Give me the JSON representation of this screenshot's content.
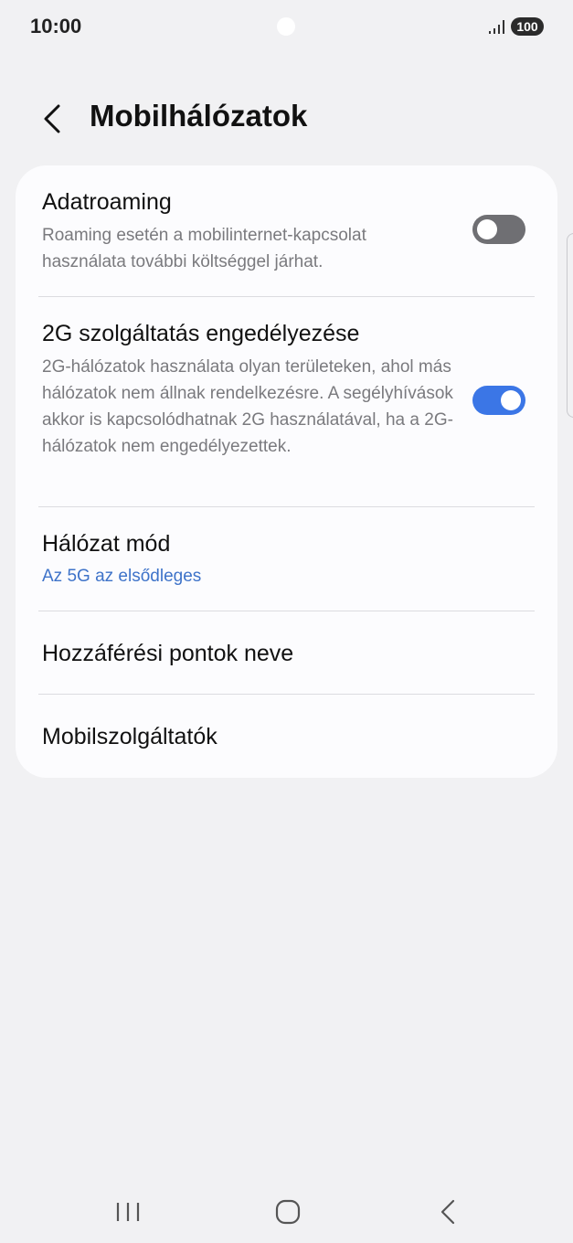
{
  "status_bar": {
    "time": "10:00",
    "battery": "100",
    "icons": [
      "camera-dot",
      "signal-icon",
      "battery-icon"
    ]
  },
  "header": {
    "title": "Mobilhálózatok",
    "back_icon": "back-arrow-icon"
  },
  "settings": [
    {
      "title": "Adatroaming",
      "subtitle": "Roaming esetén a mobilinternet-kapcsolat használata további költséggel járhat.",
      "toggle": "off"
    },
    {
      "title": "2G szolgáltatás engedélyezése",
      "subtitle": "2G-hálózatok használata olyan területeken, ahol más hálózatok nem állnak rendelkezésre. A segélyhívások akkor is kapcsolódhatnak 2G használatával, ha a 2G-hálózatok nem engedélyezettek.",
      "toggle": "on"
    },
    {
      "title": "Hálózat mód",
      "subtitle": "Az 5G az elsődleges"
    },
    {
      "title": "Hozzáférési pontok neve"
    },
    {
      "title": "Mobilszolgáltatók"
    }
  ],
  "nav_bar": {
    "icons": [
      "recents-icon",
      "home-icon",
      "back-icon"
    ]
  },
  "colors": {
    "background": "#f1f1f3",
    "card": "#fcfcfe",
    "accent": "#3e73c9",
    "toggle_on": "#3b76e6",
    "toggle_off": "#6f6f73"
  }
}
